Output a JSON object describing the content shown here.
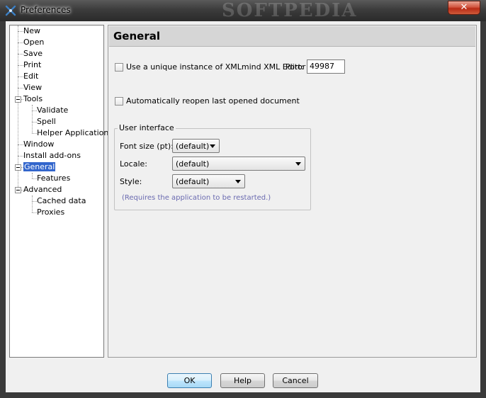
{
  "window": {
    "title": "Preferences",
    "watermark": "SOFTPEDIA",
    "close_glyph": "✕"
  },
  "tree": {
    "items": [
      {
        "label": "New"
      },
      {
        "label": "Open"
      },
      {
        "label": "Save"
      },
      {
        "label": "Print"
      },
      {
        "label": "Edit"
      },
      {
        "label": "View"
      },
      {
        "label": "Tools"
      },
      {
        "label": "Validate"
      },
      {
        "label": "Spell"
      },
      {
        "label": "Helper Applications"
      },
      {
        "label": "Window"
      },
      {
        "label": "Install add-ons"
      },
      {
        "label": "General"
      },
      {
        "label": "Features"
      },
      {
        "label": "Advanced"
      },
      {
        "label": "Cached data"
      },
      {
        "label": "Proxies"
      }
    ]
  },
  "panel": {
    "header": "General",
    "unique_instance_label": "Use a unique instance of XMLmind XML Editor",
    "port_label": "Port:",
    "port_value": "49987",
    "reopen_label": "Automatically reopen last opened document",
    "group_title": "User interface",
    "font_size_label": "Font size (pt):",
    "font_size_value": "(default)",
    "locale_label": "Locale:",
    "locale_value": "(default)",
    "style_label": "Style:",
    "style_value": "(default)",
    "restart_note": "(Requires the application to be restarted.)"
  },
  "buttons": {
    "ok": "OK",
    "help": "Help",
    "cancel": "Cancel"
  }
}
